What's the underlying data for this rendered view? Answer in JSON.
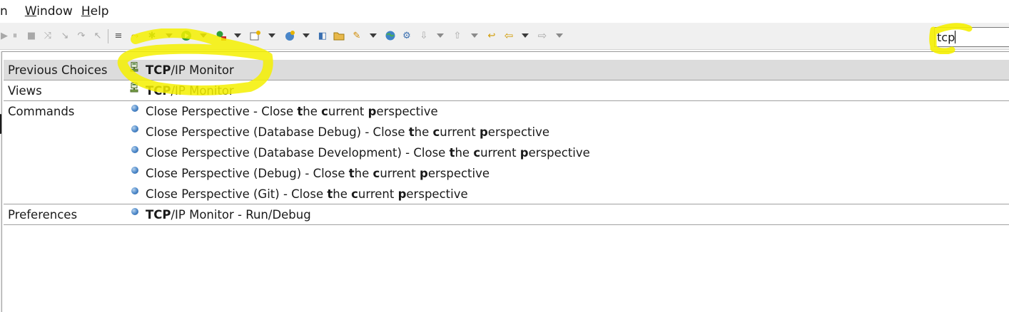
{
  "menubar": {
    "items": [
      {
        "label": "n",
        "underline": ""
      },
      {
        "label": "Window",
        "underline": "W"
      },
      {
        "label": "Help",
        "underline": "H"
      }
    ]
  },
  "toolbar": {
    "icons": [
      "resume-icon",
      "suspend-icon",
      "terminate-icon",
      "disconnect-icon",
      "step-into-icon",
      "step-over-icon",
      "step-return-icon",
      "word-wrap-icon",
      "skip-breakpoints-icon",
      "debug-icon",
      "run-icon",
      "run-external-tool-icon",
      "new-wizard-icon",
      "new-server-icon",
      "open-type-icon",
      "open-task-icon",
      "search-icon",
      "open-web-browser-icon",
      "web-service-icon",
      "next-annotation-icon",
      "previous-annotation-icon",
      "last-edit-location-icon",
      "back-icon",
      "forward-icon"
    ],
    "colors": {
      "background": "#f0f0f0",
      "green": "#2e9e3a",
      "yellow": "#e8d000"
    }
  },
  "search": {
    "value": "tcp"
  },
  "popup": {
    "groups": [
      {
        "category": "Previous Choices",
        "items": [
          {
            "icon": "tcp-ip-monitor-icon",
            "bold": "TCP",
            "rest": "/IP Monitor",
            "selected": true
          }
        ]
      },
      {
        "category": "Views",
        "items": [
          {
            "icon": "tcp-ip-monitor-icon",
            "bold": "TCP",
            "rest": "/IP Monitor"
          }
        ]
      },
      {
        "category": "Commands",
        "items": [
          {
            "icon": "command-bullet-icon",
            "text": "Close Perspective - Close the current perspective"
          },
          {
            "icon": "command-bullet-icon",
            "text": "Close Perspective (Database Debug) - Close the current perspective"
          },
          {
            "icon": "command-bullet-icon",
            "text": "Close Perspective (Database Development) - Close the current perspective"
          },
          {
            "icon": "command-bullet-icon",
            "text": "Close Perspective (Debug) - Close the current perspective"
          },
          {
            "icon": "command-bullet-icon",
            "text": "Close Perspective (Git) - Close the current perspective"
          }
        ]
      },
      {
        "category": "Preferences",
        "items": [
          {
            "icon": "command-bullet-icon",
            "bold": "TCP",
            "rest": "/IP Monitor - Run/Debug"
          }
        ]
      }
    ],
    "colors": {
      "selected_row": "#dcdcdc",
      "divider": "#a0a0a0",
      "highlight": "#f5f000"
    }
  }
}
